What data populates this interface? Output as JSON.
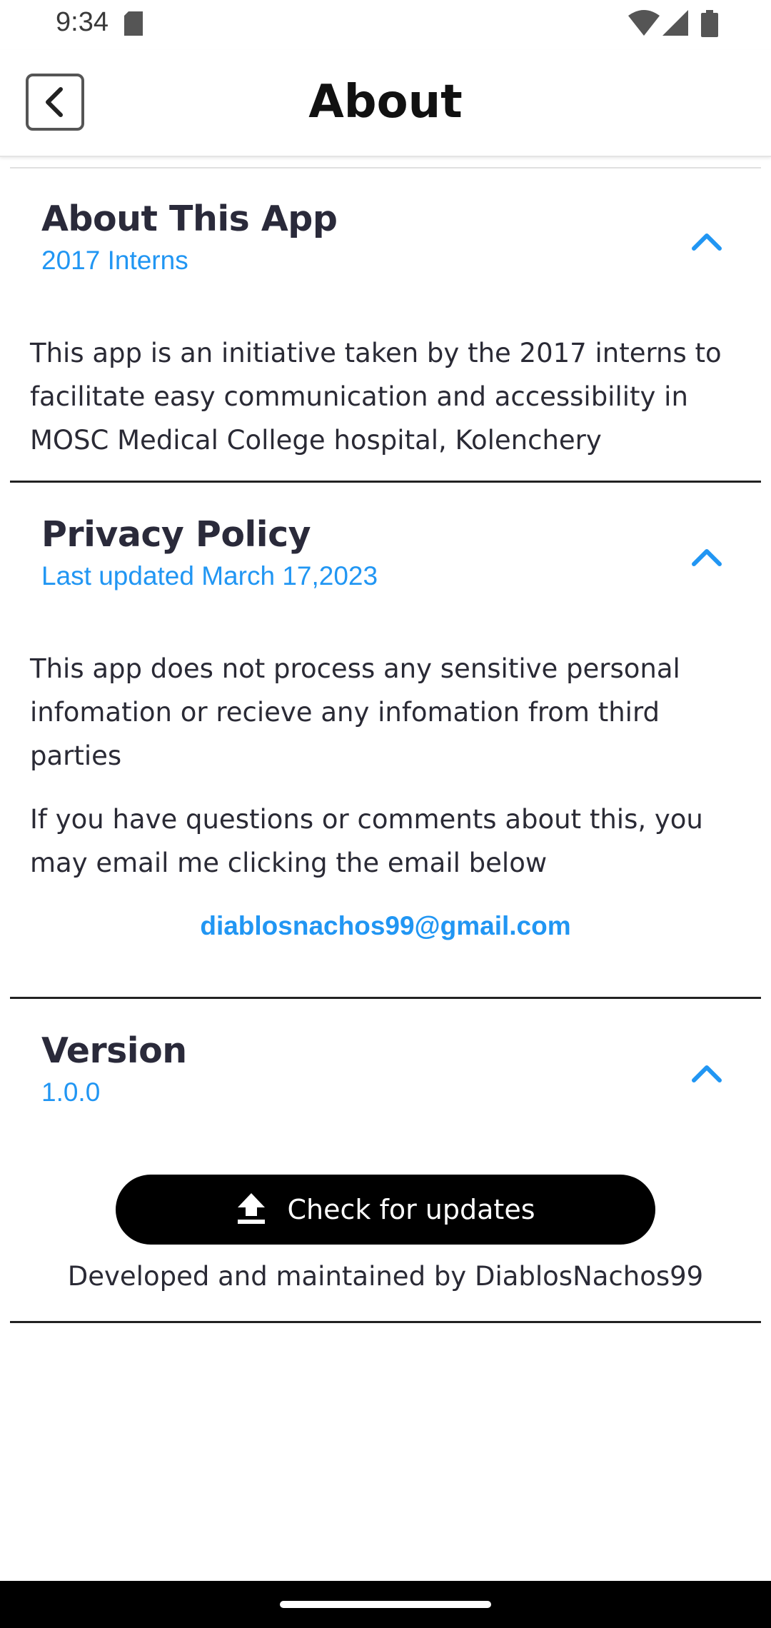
{
  "status_bar": {
    "time": "9:34",
    "icons": [
      "sd-card-icon",
      "wifi-icon",
      "signal-icon",
      "battery-icon"
    ]
  },
  "app_bar": {
    "title": "About",
    "back_icon": "chevron-left-icon"
  },
  "sections": {
    "about": {
      "title": "About This App",
      "subtitle": "2017 Interns",
      "body": "This app is an initiative taken by the 2017 interns to facilitate easy communication and accessibility in MOSC Medical College hospital, Kolenchery"
    },
    "privacy": {
      "title": "Privacy Policy",
      "subtitle": "Last updated March 17,2023",
      "body1": "This app does not process any sensitive personal infomation or recieve any infomation from third parties",
      "body2": "If you have questions or comments about this, you may email me clicking the email below",
      "email": "diablosnachos99@gmail.com"
    },
    "version": {
      "title": "Version",
      "subtitle": "1.0.0",
      "update_button": "Check for updates",
      "developer": "Developed and maintained by DiablosNachos99"
    }
  },
  "colors": {
    "accent": "#2196f3",
    "button_bg": "#000000",
    "text": "#2a2a35"
  }
}
